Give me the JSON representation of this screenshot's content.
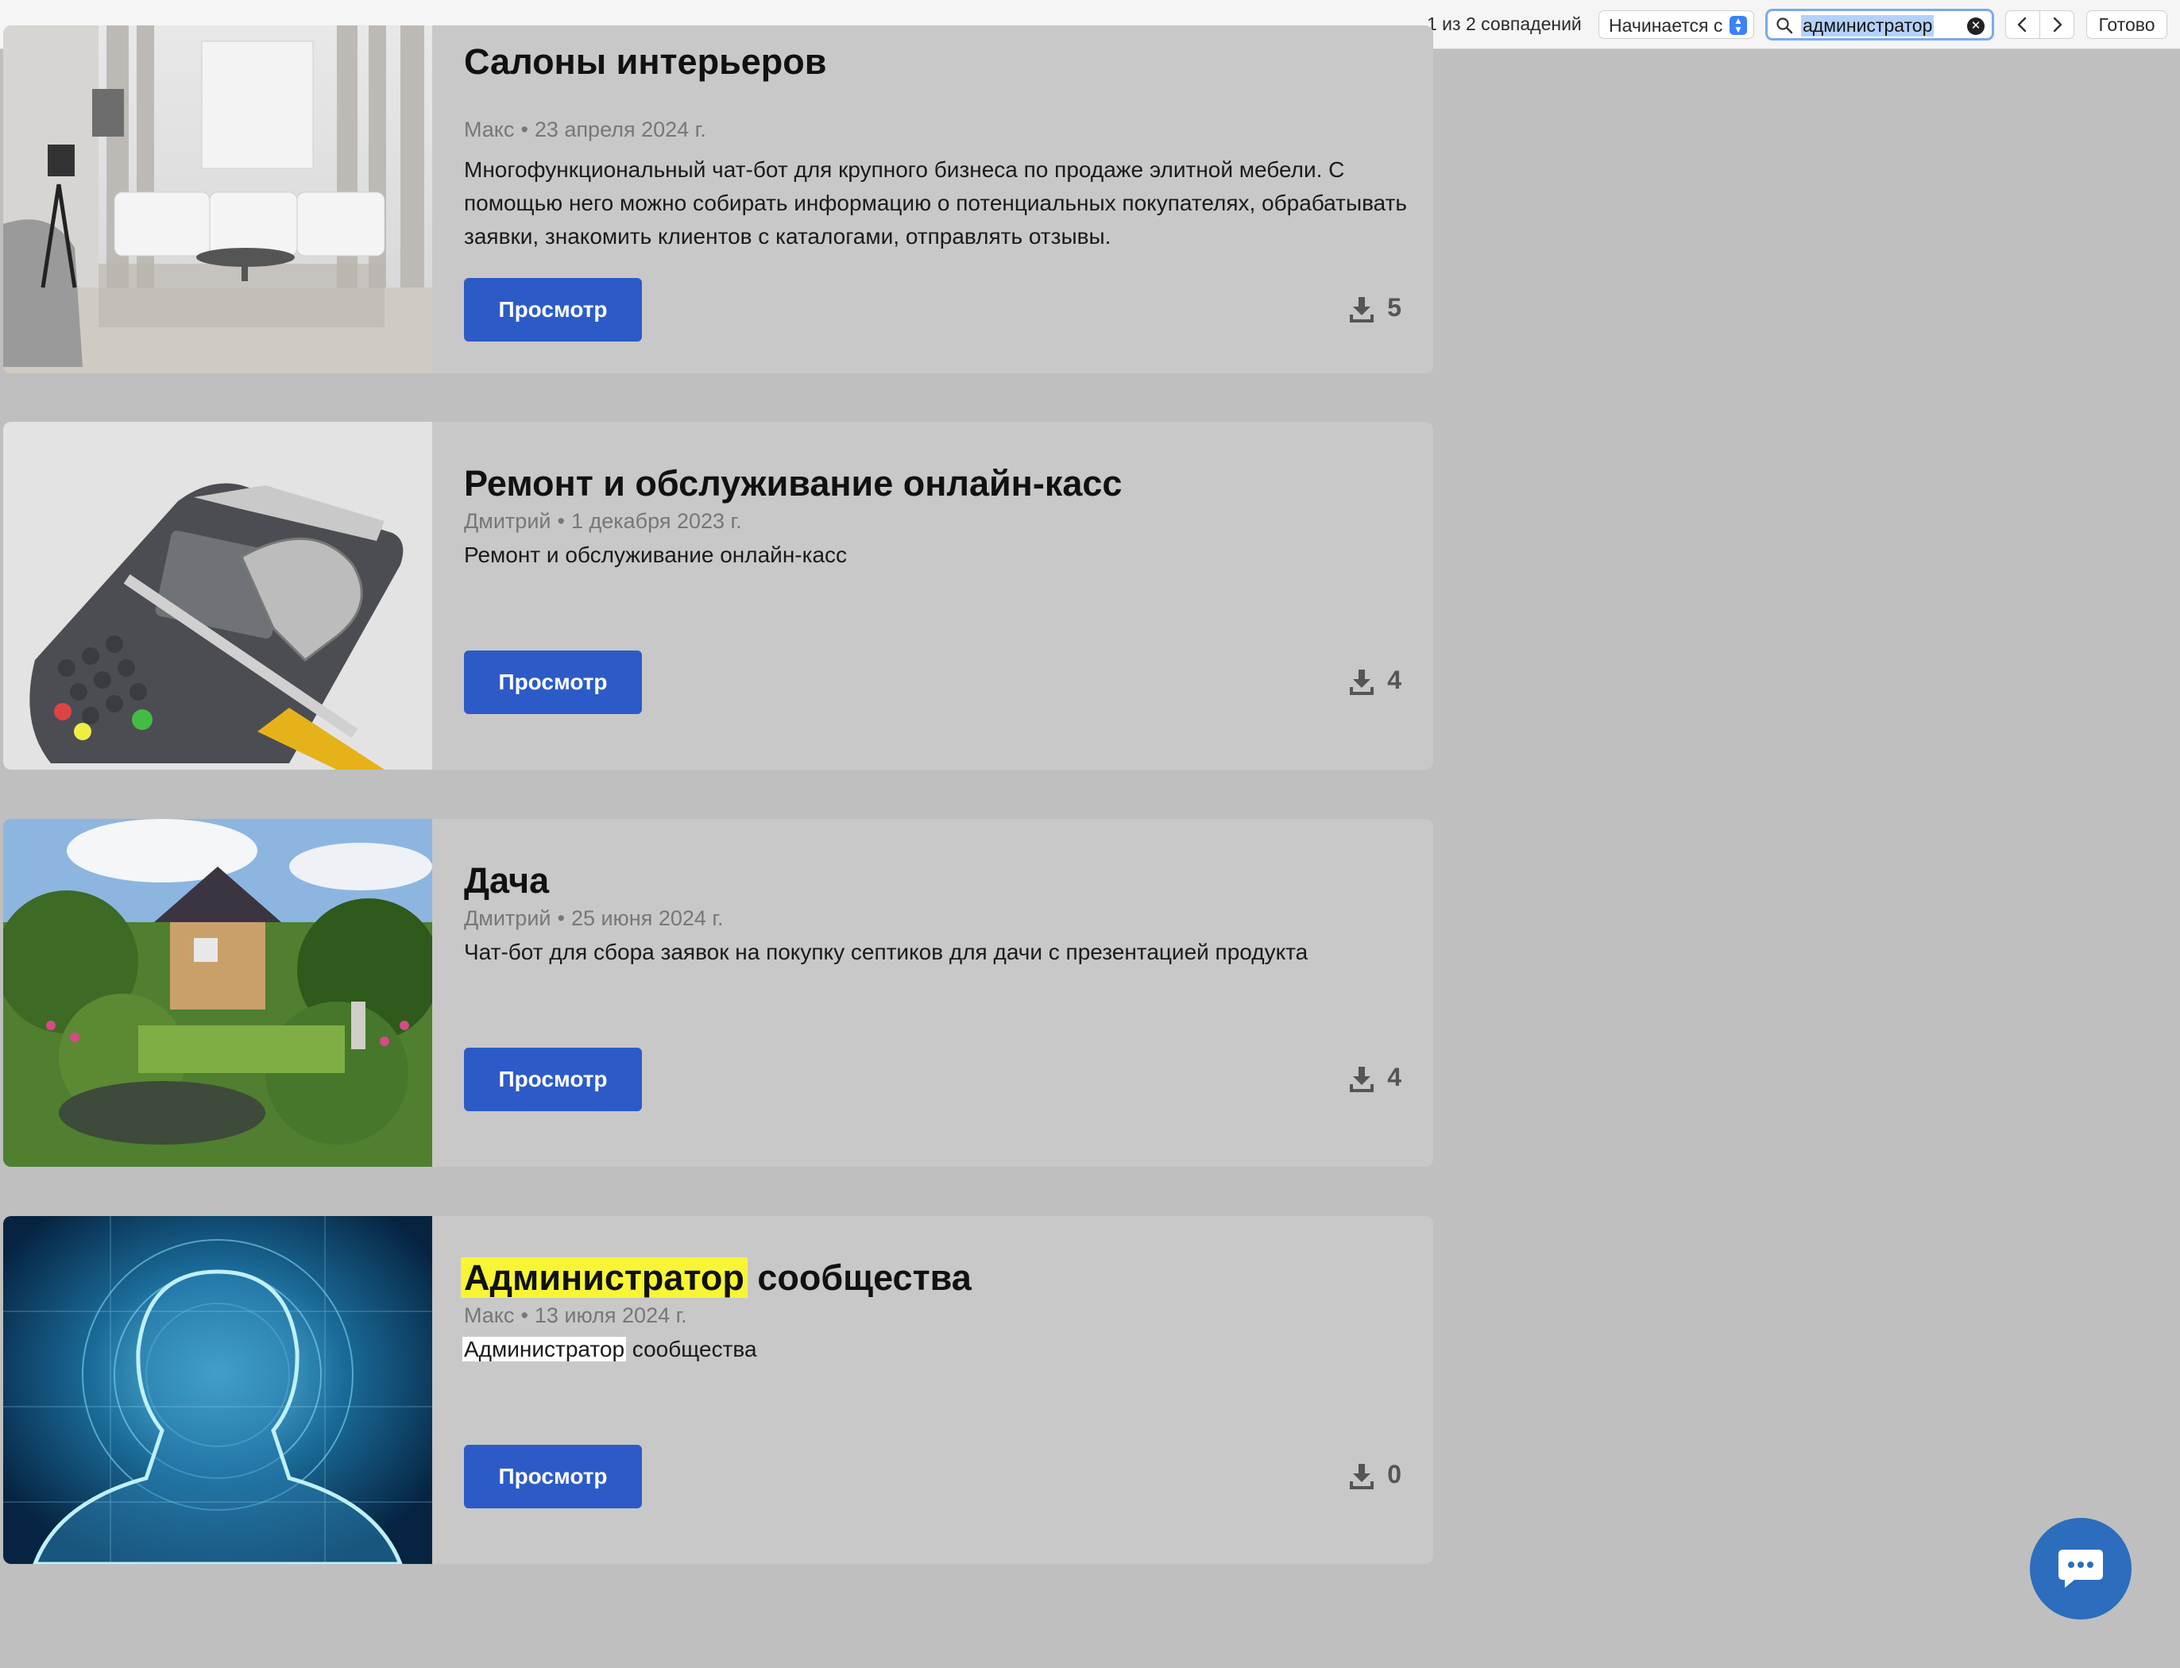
{
  "find_bar": {
    "match_count": "1 из 2 совпадений",
    "mode_label": "Начинается с",
    "search_value": "администратор",
    "done_label": "Готово"
  },
  "cards": [
    {
      "title": "Салоны интерьеров",
      "author": "Макс",
      "date": "23 апреля 2024 г.",
      "description": "Многофункциональный чат-бот для крупного бизнеса по продаже элитной мебели. С помощью него можно собирать информацию о потенциальных покупателях, обрабатывать заявки, знакомить клиентов с каталогами, отправлять отзывы.",
      "button": "Просмотр",
      "downloads": "5"
    },
    {
      "title": "Ремонт и обслуживание онлайн-касс",
      "author": "Дмитрий",
      "date": "1 декабря 2023 г.",
      "description": "Ремонт и обслуживание онлайн-касс",
      "button": "Просмотр",
      "downloads": "4"
    },
    {
      "title": "Дача",
      "author": "Дмитрий",
      "date": "25 июня 2024 г.",
      "description": "Чат-бот для сбора заявок на покупку септиков для дачи с презентацией продукта",
      "button": "Просмотр",
      "downloads": "4"
    },
    {
      "title_highlight": "Администратор",
      "title_rest": " сообщества",
      "author": "Макс",
      "date": "13 июля 2024 г.",
      "desc_highlight": "Администратор",
      "desc_rest": " сообщества",
      "button": "Просмотр",
      "downloads": "0"
    }
  ],
  "meta_separator": "•",
  "colors": {
    "page_bg": "#bfbfbf",
    "card_bg": "#c8c8c8",
    "button_bg": "#2c5bc8",
    "highlight": "#f7f536",
    "chat_bg": "#2d6dbd"
  }
}
